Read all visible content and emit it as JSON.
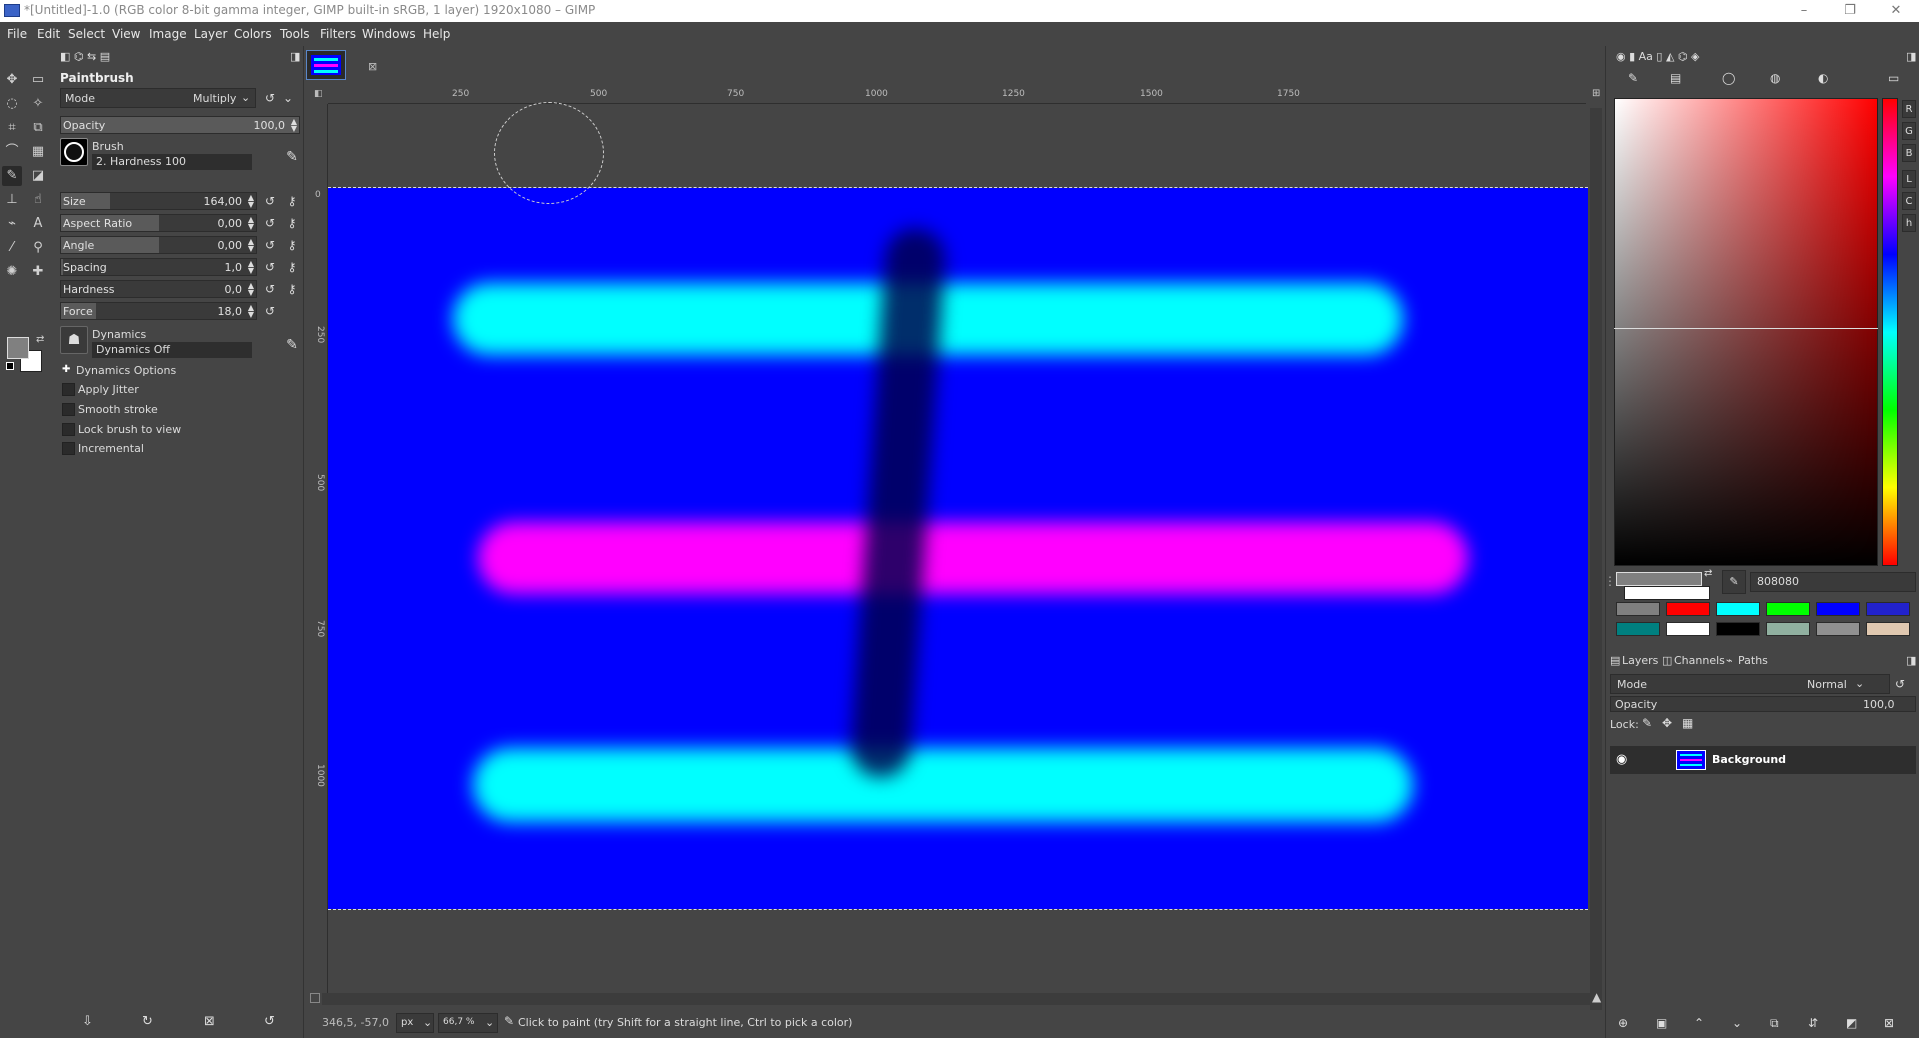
{
  "window": {
    "title": "*[Untitled]-1.0 (RGB color 8-bit gamma integer, GIMP built-in sRGB, 1 layer) 1920x1080 – GIMP",
    "controls": [
      "–",
      "❐",
      "✕"
    ]
  },
  "menu": [
    "File",
    "Edit",
    "Select",
    "View",
    "Image",
    "Layer",
    "Colors",
    "Tools",
    "Filters",
    "Windows",
    "Help"
  ],
  "tool_options": {
    "title": "Paintbrush",
    "mode_label": "Mode",
    "mode_value": "Multiply",
    "opacity": {
      "label": "Opacity",
      "value": "100,0",
      "fraction": 1.0
    },
    "brush_label": "Brush",
    "brush_name": "2. Hardness 100",
    "size": {
      "label": "Size",
      "value": "164,00",
      "fraction": 0.25
    },
    "aspect_ratio": {
      "label": "Aspect Ratio",
      "value": "0,00",
      "fraction": 0.5
    },
    "angle": {
      "label": "Angle",
      "value": "0,00",
      "fraction": 0.5
    },
    "spacing": {
      "label": "Spacing",
      "value": "1,0",
      "fraction": 0.01
    },
    "hardness": {
      "label": "Hardness",
      "value": "0,0",
      "fraction": 0.0
    },
    "force": {
      "label": "Force",
      "value": "18,0",
      "fraction": 0.18
    },
    "dynamics_label": "Dynamics",
    "dynamics_name": "Dynamics Off",
    "dynamics_options": "Dynamics Options",
    "checkboxes": [
      "Apply Jitter",
      "Smooth stroke",
      "Lock brush to view",
      "Incremental"
    ]
  },
  "rulers": {
    "top": [
      "250",
      "500",
      "750",
      "1000",
      "1250",
      "1500",
      "1750"
    ],
    "left": [
      "0",
      "250",
      "500",
      "750",
      "1000"
    ]
  },
  "canvas": {
    "background_color": "#0000ff",
    "stroke_colors": {
      "cyan": "#00ffff",
      "magenta": "#ff00ff",
      "dark": "#00004a"
    }
  },
  "status": {
    "coords": "346,5, -57,0",
    "unit": "px",
    "zoom": "66,7 %",
    "message": "Click to paint (try Shift for a straight line, Ctrl to pick a color)"
  },
  "colors_panel": {
    "hex_value": "808080",
    "channels": [
      "R",
      "G",
      "B",
      "L",
      "C",
      "h"
    ],
    "history": [
      "#808080",
      "#ff0000",
      "#00ffff",
      "#00ff00",
      "#0000ff",
      "#2222cc",
      "#008080",
      "#ffffff",
      "#000000",
      "#90b0a0",
      "#909090",
      "#e0c8b0"
    ]
  },
  "layers_panel": {
    "tabs": [
      "Layers",
      "Channels",
      "Paths"
    ],
    "mode_label": "Mode",
    "mode_value": "Normal",
    "opacity_label": "Opacity",
    "opacity_value": "100,0",
    "lock_label": "Lock:",
    "layer_name": "Background"
  }
}
